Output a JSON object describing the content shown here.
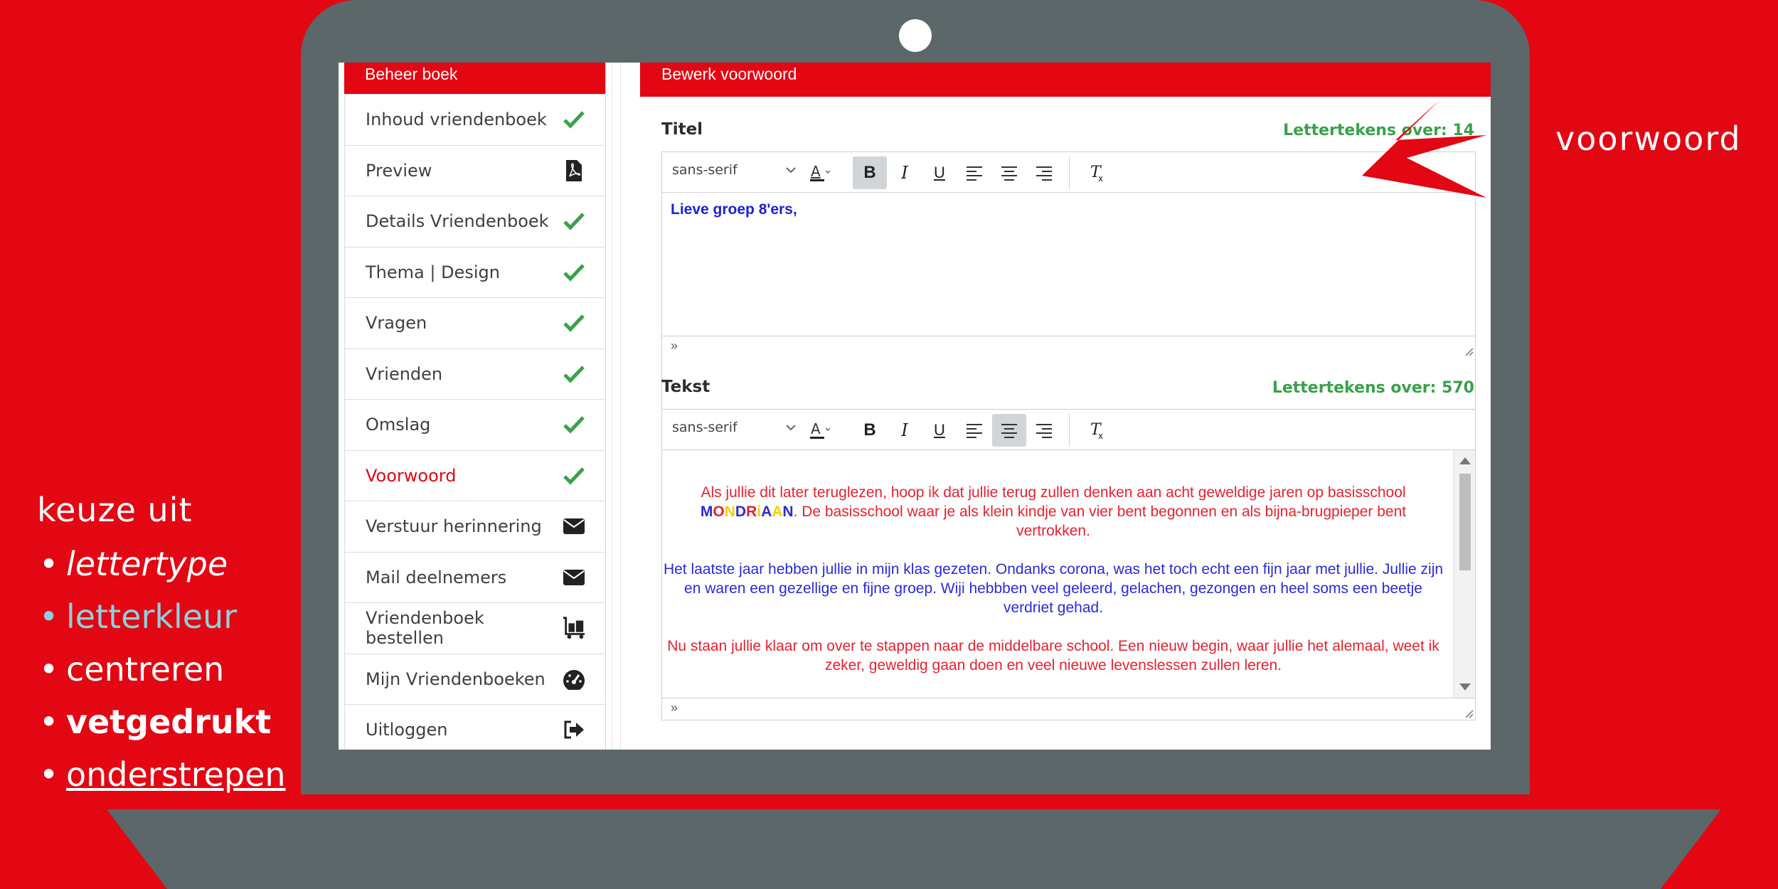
{
  "sidebar": {
    "header": "Beheer boek",
    "items": [
      {
        "label": "Inhoud vriendenboek",
        "icon": "check-icon"
      },
      {
        "label": "Preview",
        "icon": "pdf-icon"
      },
      {
        "label": "Details Vriendenboek",
        "icon": "check-icon"
      },
      {
        "label": "Thema | Design",
        "icon": "check-icon"
      },
      {
        "label": "Vragen",
        "icon": "check-icon"
      },
      {
        "label": "Vrienden",
        "icon": "check-icon"
      },
      {
        "label": "Omslag",
        "icon": "check-icon"
      },
      {
        "label": "Voorwoord",
        "icon": "check-icon",
        "active": true
      },
      {
        "label": "Verstuur herinnering",
        "icon": "envelope-icon"
      },
      {
        "label": "Mail deelnemers",
        "icon": "envelope-icon"
      },
      {
        "label": "Vriendenboek bestellen",
        "icon": "luggage-cart-icon"
      },
      {
        "label": "Mijn Vriendenboeken",
        "icon": "dashboard-icon"
      },
      {
        "label": "Uitloggen",
        "icon": "sign-out-icon"
      }
    ]
  },
  "main": {
    "header": "Bewerk voorwoord",
    "title_field": {
      "label": "Titel",
      "counter": "Lettertekens over: 14",
      "font": "sans-serif",
      "content": "Lieve groep 8'ers,",
      "status": "»"
    },
    "text_field": {
      "label": "Tekst",
      "counter": "Lettertekens over: 570",
      "font": "sans-serif",
      "status": "»",
      "paragraphs": {
        "p1_a": "Als jullie dit later teruglezen, hoop ik dat jullie terug zullen denken aan acht geweldige jaren op basisschool ",
        "school_letters": [
          "M",
          "O",
          "N",
          "D",
          "R",
          "i",
          "A",
          "A",
          "N"
        ],
        "p1_b": ". De basisschool waar je als klein kindje van vier bent  begonnen en als bijna-brugpieper bent vertrokken.",
        "p2": "Het laatste jaar hebben jullie in mijn klas gezeten. Ondanks corona, was het toch echt een fijn jaar met jullie. Jullie zijn en waren een gezellige en fijne groep. Wiji hebbben veel geleerd, gelachen, gezongen en heel soms een beetje verdriet gehad.",
        "p3": "Nu staan jullie klaar om over te stappen naar de middelbare school. Een nieuw begin, waar jullie het alemaal, weet ik zeker, geweldig gaan doen en veel nieuwe levenslessen zullen leren."
      }
    }
  },
  "annotations": {
    "arrow_label": "voorwoord",
    "choices_title": "keuze uit",
    "choices": [
      "lettertype",
      "letterkleur",
      "centreren",
      "vetgedrukt",
      "onderstrepen"
    ]
  },
  "colors": {
    "brand_red": "#e30613",
    "laptop_gray": "#5b6768",
    "check_green": "#3aa14a",
    "text_blue": "#2a2ad8",
    "text_red": "#e5222f",
    "mondriaan": [
      "#2a2ad8",
      "#e5222f",
      "#f2d000",
      "#2a2ad8",
      "#e5222f",
      "#f2d000",
      "#2a2ad8",
      "#f2d000",
      "#2a2ad8"
    ]
  }
}
